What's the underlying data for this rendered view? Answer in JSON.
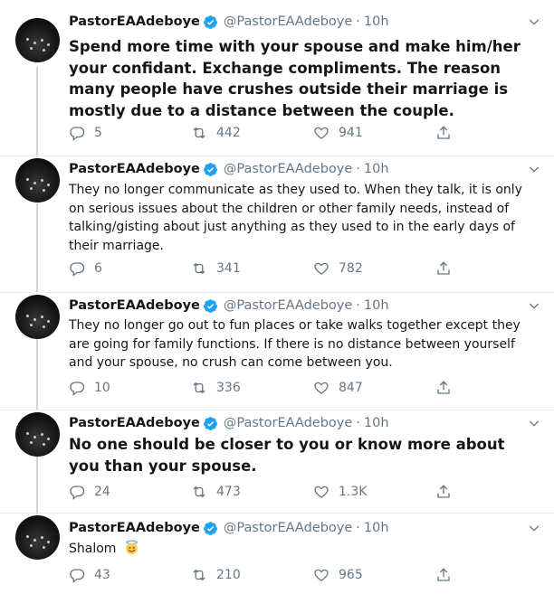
{
  "author": {
    "name": "PastorEAAdeboye",
    "handle": "@PastorEAAdeboye",
    "time": "10h",
    "verified_color": "#1da1f2"
  },
  "icons": {
    "reply": "reply-icon",
    "retweet": "retweet-icon",
    "like": "heart-icon",
    "share": "share-icon",
    "caret": "chevron-down-icon",
    "verified": "verified-badge-icon"
  },
  "tweets": [
    {
      "text": "Spend more time with your spouse and make him/her your confidant. Exchange compliments. The reason many people have crushes outside their marriage is mostly due to a distance between the couple.",
      "replies": "5",
      "retweets": "442",
      "likes": "941"
    },
    {
      "text": "They no longer communicate as they used to. When they talk, it is only on serious issues about the children or other family needs, instead of talking/gisting about just anything as they used to in the early days of their marriage.",
      "replies": "6",
      "retweets": "341",
      "likes": "782"
    },
    {
      "text": "They no longer go out to fun places or take walks together except they are going for family functions. If there is no distance between yourself and your spouse, no crush can come between you.",
      "replies": "10",
      "retweets": "336",
      "likes": "847"
    },
    {
      "text": "No one should be closer to you or know more about you than your spouse.",
      "replies": "24",
      "retweets": "473",
      "likes": "1.3K"
    },
    {
      "text": "Shalom",
      "emoji": "smiling-face-with-halo-emoji",
      "replies": "43",
      "retweets": "210",
      "likes": "965"
    }
  ]
}
